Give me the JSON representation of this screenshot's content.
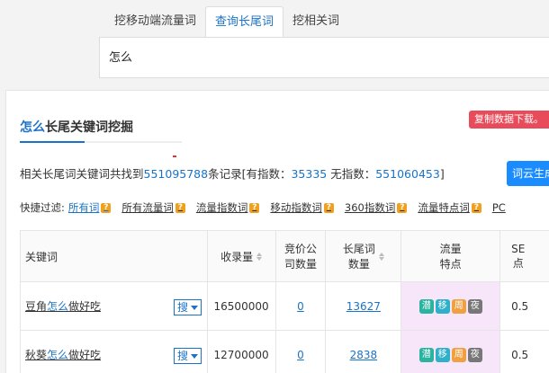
{
  "tabs": [
    {
      "label": "挖移动端流量词"
    },
    {
      "label": "查询长尾词"
    },
    {
      "label": "挖相关词"
    }
  ],
  "search": {
    "value": "怎么"
  },
  "panel": {
    "title_kw": "怎么",
    "title_rest": "长尾关键词挖掘",
    "copy_button": "复制数据下载。",
    "summary": {
      "prefix": "相关长尾词关键词共找到",
      "total": "551095788",
      "mid1": "条记录[有指数：",
      "with_index": "35335",
      "mid2": " 无指数：",
      "no_index": "551060453",
      "suffix": "]"
    },
    "cloud_button": "词云生成"
  },
  "filters": {
    "label": "快捷过滤:",
    "items": [
      {
        "label": "所有词"
      },
      {
        "label": "所有流量词"
      },
      {
        "label": "流量指数词"
      },
      {
        "label": "移动指数词"
      },
      {
        "label": "360指数词"
      },
      {
        "label": "流量特点词"
      },
      {
        "label": "PC"
      }
    ],
    "help_glyph": "?"
  },
  "table": {
    "headers": {
      "keyword": "关键词",
      "indexed": "收录量",
      "bid_line1": "竞价公",
      "bid_line2": "司数量",
      "longtail_line1": "长尾词",
      "longtail_line2": "数量",
      "traffic_line1": "流量",
      "traffic_line2": "特点",
      "se_line1": "SE",
      "se_line2": "点"
    },
    "rows": [
      {
        "kw_a": "豆角",
        "kw_hl": "怎么",
        "kw_b": "做好吃",
        "sou": "搜",
        "indexed": "16500000",
        "bid": "0",
        "longtail": "13627",
        "badges": [
          "潜",
          "移",
          "周",
          "夜"
        ],
        "se": "0.5"
      },
      {
        "kw_a": "秋葵",
        "kw_hl": "怎么",
        "kw_b": "做好吃",
        "sou": "搜",
        "indexed": "12700000",
        "bid": "0",
        "longtail": "2838",
        "badges": [
          "潜",
          "移",
          "周",
          "夜"
        ],
        "se": "0.5"
      }
    ]
  },
  "colors": {
    "accent": "#1a73c8",
    "copy_btn": "#e84c5a",
    "cloud_btn": "#1a8cff"
  }
}
